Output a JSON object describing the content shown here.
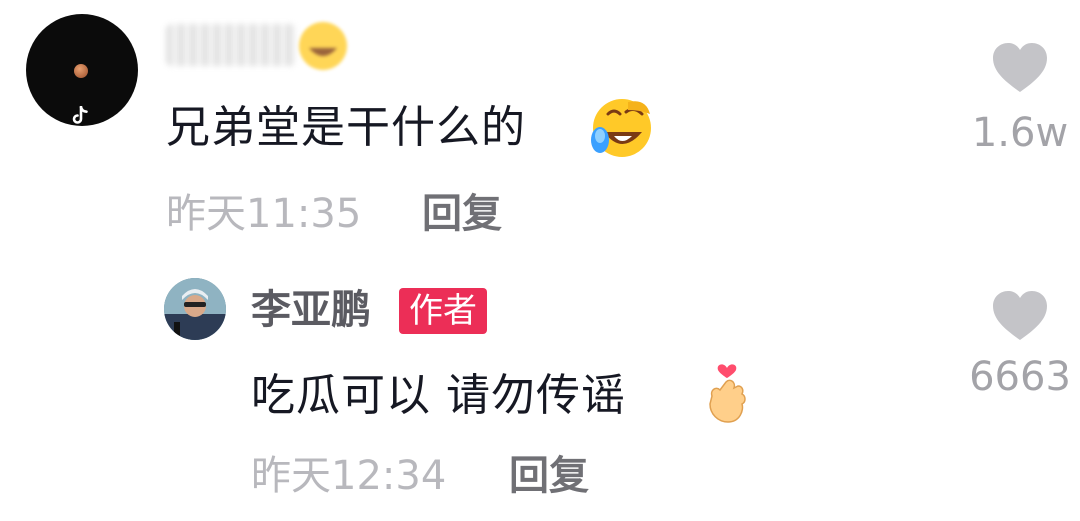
{
  "comment": {
    "text": "兄弟堂是干什么的",
    "time": "昨天11:35",
    "reply_label": "回复",
    "likes": "1.6w"
  },
  "reply": {
    "author": "李亚鹏",
    "badge": "作者",
    "text": "吃瓜可以 请勿传谣",
    "time": "昨天12:34",
    "reply_label": "回复",
    "likes": "6663"
  },
  "icons": {
    "comment_emoji": "laughing-crying-emoji-icon",
    "reply_emoji": "finger-heart-emoji-icon",
    "like": "heart-icon"
  },
  "colors": {
    "badge": "#ec2e57",
    "primary_text": "#161823",
    "secondary_text": "#b8b8bd",
    "like_icon": "#c4c4c8"
  }
}
